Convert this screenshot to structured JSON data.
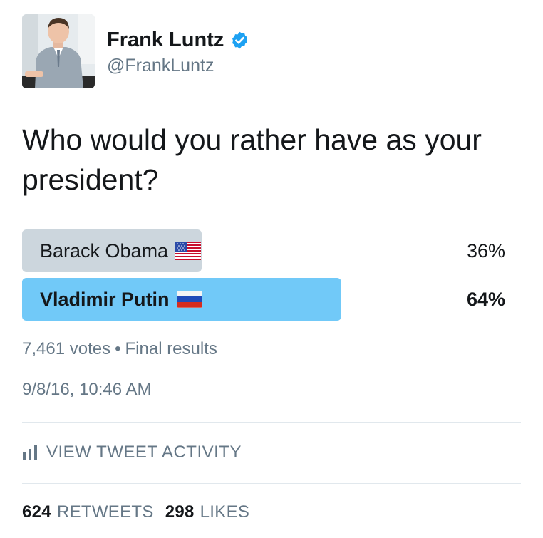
{
  "author": {
    "display_name": "Frank Luntz",
    "handle": "@FrankLuntz",
    "verified": true
  },
  "tweet": {
    "text_line1": "Who would you rather have as your",
    "text_line2": "president?"
  },
  "poll": {
    "options": [
      {
        "label": "Barack Obama",
        "flag_icon": "us-flag-icon",
        "percent_label": "36%",
        "percent": 36,
        "winner": false
      },
      {
        "label": "Vladimir Putin",
        "flag_icon": "russia-flag-icon",
        "percent_label": "64%",
        "percent": 64,
        "winner": true
      }
    ],
    "votes": "7,461 votes",
    "separator": "•",
    "status": "Final results"
  },
  "timestamp": "9/8/16, 10:46 AM",
  "activity": {
    "icon": "bar-chart-icon",
    "label": "VIEW TWEET ACTIVITY"
  },
  "engagement": {
    "retweets_count": "624",
    "retweets_label": "RETWEETS",
    "likes_count": "298",
    "likes_label": "LIKES"
  },
  "colors": {
    "text": "#14171a",
    "secondary": "#657786",
    "verified": "#1da1f2",
    "loser_bar": "#ccd6dd",
    "winner_bar": "#71c9f8",
    "divider": "#e1e8ed"
  }
}
